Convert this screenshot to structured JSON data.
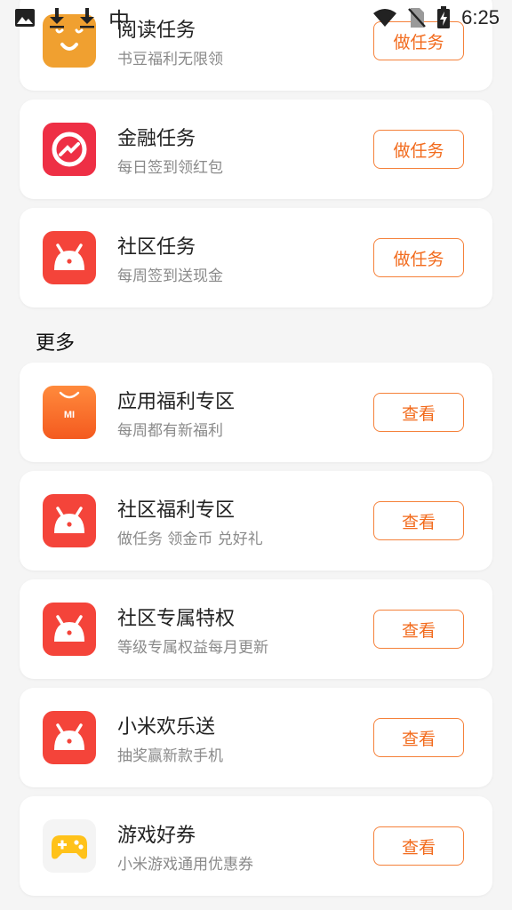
{
  "status_bar": {
    "time": "6:25",
    "ime_char": "中",
    "icons": [
      "image-icon",
      "download-icon",
      "download-icon",
      "wifi-icon",
      "no-sim-icon",
      "battery-charging-icon"
    ]
  },
  "tasks": [
    {
      "title": "阅读任务",
      "subtitle": "书豆福利无限领",
      "button": "做任务",
      "icon": "reading-app-icon"
    },
    {
      "title": "金融任务",
      "subtitle": "每日签到领红包",
      "button": "做任务",
      "icon": "finance-app-icon"
    },
    {
      "title": "社区任务",
      "subtitle": "每周签到送现金",
      "button": "做任务",
      "icon": "community-app-icon"
    }
  ],
  "more": {
    "section_title": "更多",
    "items": [
      {
        "title": "应用福利专区",
        "subtitle": "每周都有新福利",
        "button": "查看",
        "icon": "app-store-icon",
        "icon_text": "MI"
      },
      {
        "title": "社区福利专区",
        "subtitle": "做任务 领金币 兑好礼",
        "button": "查看",
        "icon": "community-app-icon"
      },
      {
        "title": "社区专属特权",
        "subtitle": "等级专属权益每月更新",
        "button": "查看",
        "icon": "community-app-icon"
      },
      {
        "title": "小米欢乐送",
        "subtitle": "抽奖赢新款手机",
        "button": "查看",
        "icon": "community-app-icon"
      },
      {
        "title": "游戏好券",
        "subtitle": "小米游戏通用优惠券",
        "button": "查看",
        "icon": "game-center-icon"
      }
    ]
  },
  "colors": {
    "accent": "#f26b1d",
    "button_border": "#f5813a",
    "background": "#f5f5f5",
    "reading_icon": "#f0a030",
    "finance_icon": "#ee2f45",
    "community_icon": "#f4443a",
    "app_store_icon": "#f86d2d"
  }
}
